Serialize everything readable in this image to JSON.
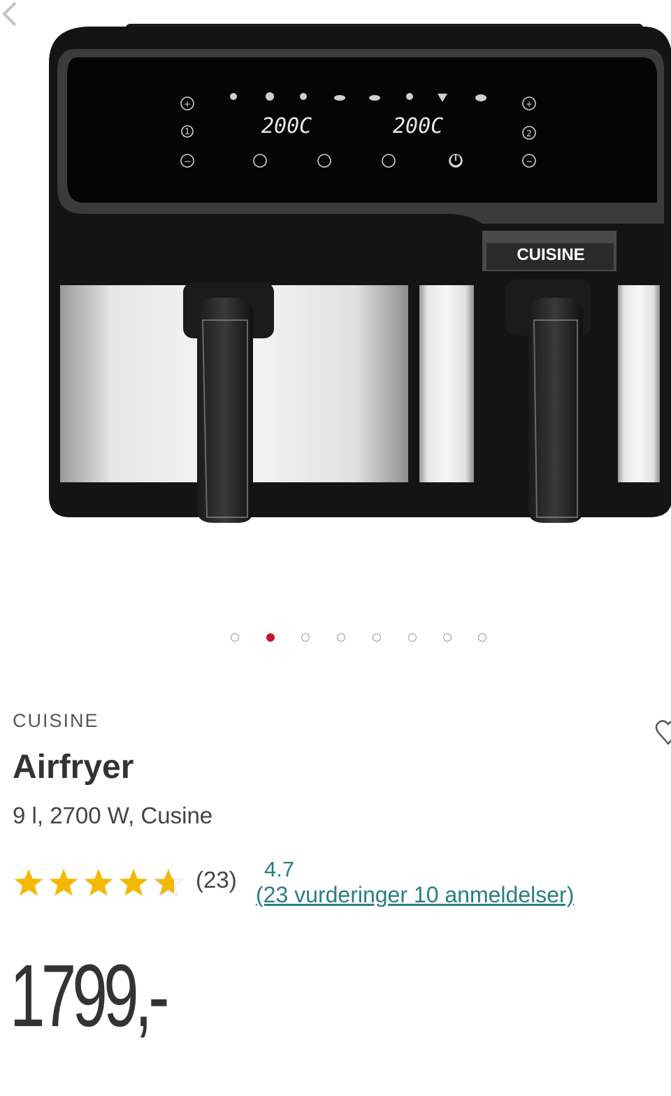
{
  "gallery": {
    "image_alt": "Airfryer",
    "product_logo": "CUISINE",
    "display_left": "200C",
    "display_right": "200C",
    "zone_left": "1",
    "zone_right": "2",
    "prev_icon": "chevron-left-icon",
    "slide_count": 8,
    "active_slide": 2
  },
  "product": {
    "brand": "CUISINE",
    "title": "Airfryer",
    "subtitle": "9 l, 2700 W, Cusine",
    "wishlist_icon": "heart-outline-icon"
  },
  "rating": {
    "stars_value": 4.7,
    "stars_max": 5,
    "count_label": "(23)",
    "score": "4.7",
    "link_label": "(23 vurderinger 10 anmeldelser)",
    "star_color": "#f5b800"
  },
  "price": {
    "label": "1799,-"
  },
  "colors": {
    "accent_active_dot": "#c8102e",
    "link": "#2a7f80"
  }
}
